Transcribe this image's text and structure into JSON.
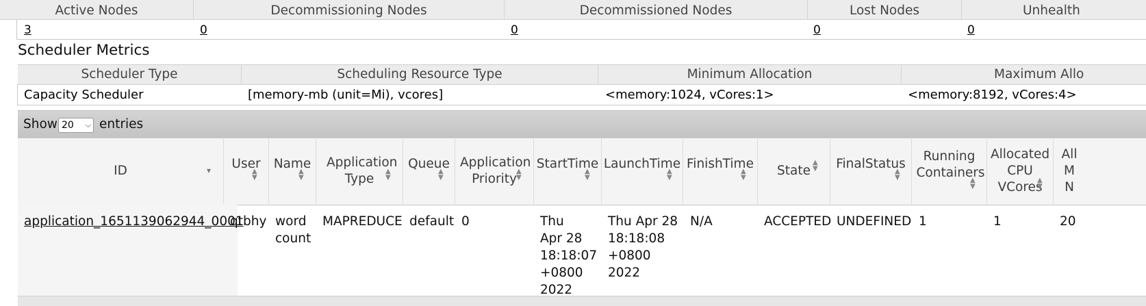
{
  "cluster_metrics": {
    "headers": [
      "Active Nodes",
      "Decommissioning Nodes",
      "Decommissioned Nodes",
      "Lost Nodes",
      "Unhealth"
    ],
    "values": [
      "3",
      "0",
      "0",
      "0",
      "0"
    ]
  },
  "scheduler_metrics": {
    "title": "Scheduler Metrics",
    "headers": [
      "Scheduler Type",
      "Scheduling Resource Type",
      "Minimum Allocation",
      "Maximum Allo"
    ],
    "values": [
      "Capacity Scheduler",
      "[memory-mb (unit=Mi), vcores]",
      "<memory:1024, vCores:1>",
      "<memory:8192, vCores:4>"
    ]
  },
  "apps_table": {
    "show_label": "Show",
    "entries_label": "entries",
    "page_size": "20",
    "columns": [
      "ID",
      "User",
      "Name",
      "Application Type",
      "Queue",
      "Application Priority",
      "StartTime",
      "LaunchTime",
      "FinishTime",
      "State",
      "FinalStatus",
      "Running Containers",
      "Allocated CPU VCores",
      "All M N"
    ],
    "row": {
      "id": "application_1651139062944_0001",
      "user": "qtbhy",
      "name": "word count",
      "type": "MAPREDUCE",
      "queue": "default",
      "priority": "0",
      "start_time": "Thu Apr 28 18:18:07 +0800 2022",
      "launch_time": "Thu Apr 28 18:18:08 +0800 2022",
      "finish_time": "N/A",
      "state": "ACCEPTED",
      "final_status": "UNDEFINED",
      "running_containers": "1",
      "allocated_vcores": "1",
      "allocated_memory": "20"
    }
  },
  "colors": {
    "header_bg": "#ececec",
    "toolbar_bg": "#c9c9c9",
    "id_column_bg": "#f5f5f5"
  }
}
